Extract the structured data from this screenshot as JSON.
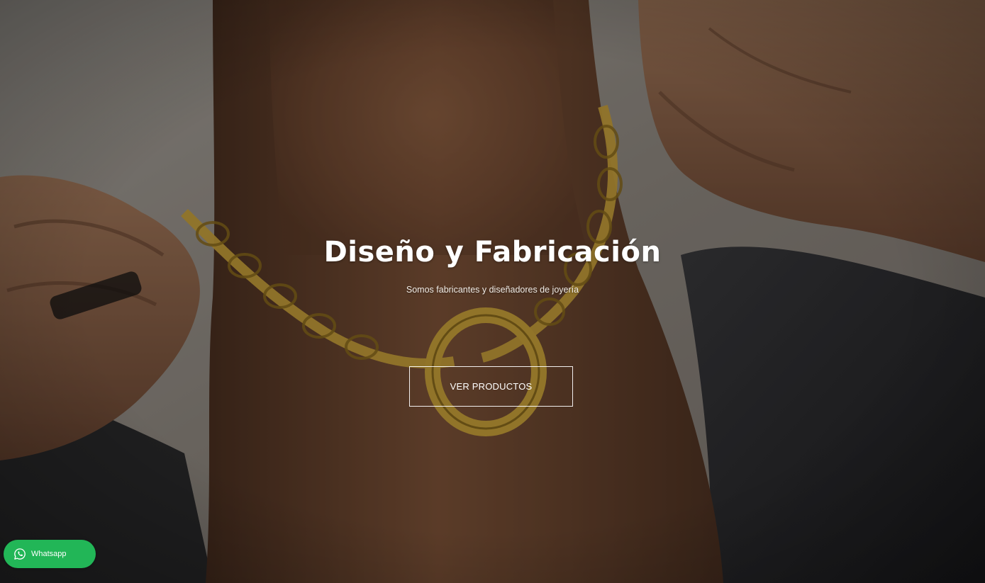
{
  "hero": {
    "title": "Diseño y Fabricación",
    "subtitle": "Somos fabricantes y diseñadores de joyería",
    "cta_label": "VER PRODUCTOS"
  },
  "whatsapp": {
    "label": "Whatsapp",
    "icon": "whatsapp-icon",
    "color": "#22b657"
  },
  "colors": {
    "text": "#ffffff",
    "overlay": "#2b2a28",
    "gold": "#c9a13a"
  }
}
